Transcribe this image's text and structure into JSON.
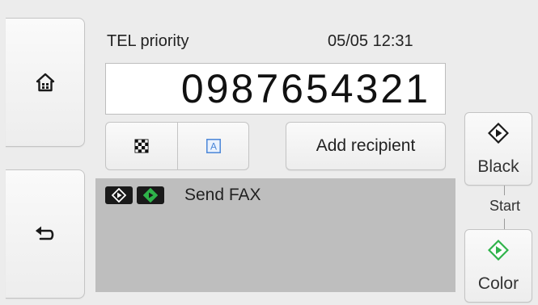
{
  "header": {
    "mode_label": "TEL priority",
    "datetime": "05/05 12:31"
  },
  "number_display": {
    "value": "0987654321"
  },
  "scan_settings": {
    "resolution_icon": "checkerboard-icon",
    "contrast_icon": "letter-a-icon",
    "contrast_letter": "A"
  },
  "actions": {
    "add_recipient_label": "Add recipient"
  },
  "send_panel": {
    "label": "Send FAX",
    "icons": [
      "black-start-icon",
      "color-start-icon"
    ]
  },
  "start": {
    "label": "Start",
    "black_label": "Black",
    "color_label": "Color"
  },
  "nav": {
    "home_icon": "home-icon",
    "back_icon": "back-arrow-icon"
  },
  "colors": {
    "start_black": "#1a1a1a",
    "start_green": "#2fb34a",
    "panel_gray": "#bebebe",
    "contrast_blue": "#4a86d8"
  }
}
